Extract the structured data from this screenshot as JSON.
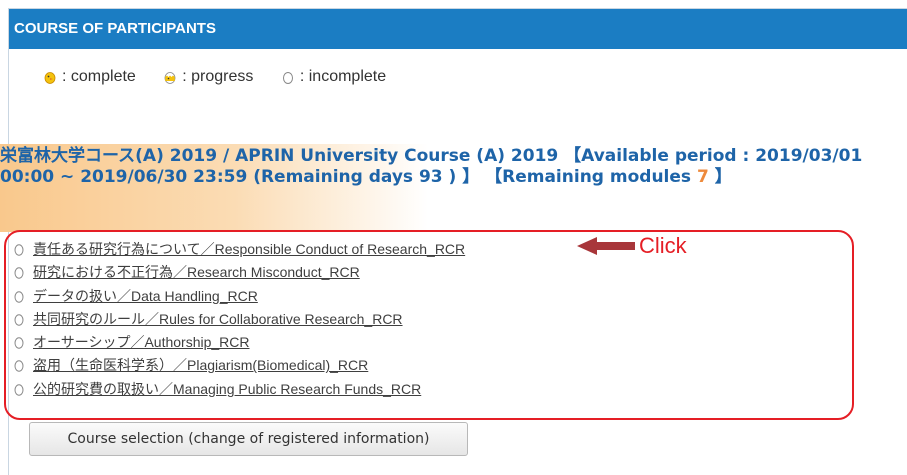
{
  "panel": {
    "title": "COURSE OF PARTICIPANTS"
  },
  "legend": [
    {
      "icon": "chick-icon",
      "label": ": complete"
    },
    {
      "icon": "hatching-egg-icon",
      "label": ": progress"
    },
    {
      "icon": "egg-icon",
      "label": ": incomplete"
    }
  ],
  "course": {
    "title_line": "栄富林大学コース(A) 2019 / APRIN University Course (A) 2019 【Available period : 2019/03/01 00:00 ~ 2019/06/30 23:59 (Remaining days 93 ) 】 【Remaining modules",
    "remaining_modules": "7",
    "title_end": " 】"
  },
  "modules": [
    "責任ある研究行為について／Responsible Conduct of Research_RCR",
    "研究における不正行為／Research Misconduct_RCR",
    "データの扱い／Data Handling_RCR",
    "共同研究のルール／Rules for Collaborative Research_RCR",
    "オーサーシップ／Authorship_RCR",
    "盗用（生命医科学系）／Plagiarism(Biomedical)_RCR",
    "公的研究費の取扱い／Managing Public Research Funds_RCR"
  ],
  "annotation": {
    "label": "Click",
    "color": "#e51e25"
  },
  "buttons": {
    "course_selection": "Course selection (change of registered information)"
  }
}
